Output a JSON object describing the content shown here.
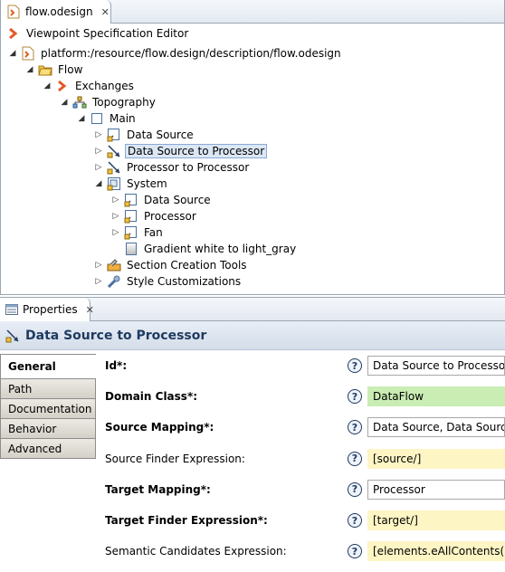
{
  "editor": {
    "tab_label": "flow.odesign",
    "title": "Viewpoint Specification Editor",
    "tree": [
      {
        "label": "platform:/resource/flow.design/description/flow.odesign",
        "icon": "odesign-file-icon",
        "arrow": "expanded",
        "depth": 0,
        "selected": false
      },
      {
        "label": "Flow",
        "icon": "viewpoint-folder-icon",
        "arrow": "expanded",
        "depth": 1,
        "selected": false
      },
      {
        "label": "Exchanges",
        "icon": "representation-icon",
        "arrow": "expanded",
        "depth": 2,
        "selected": false
      },
      {
        "label": "Topography",
        "icon": "diagram-description-icon",
        "arrow": "expanded",
        "depth": 3,
        "selected": false
      },
      {
        "label": "Main",
        "icon": "layer-icon",
        "arrow": "expanded",
        "depth": 4,
        "selected": false
      },
      {
        "label": "Data Source",
        "icon": "node-mapping-icon",
        "arrow": "collapsed",
        "depth": 5,
        "selected": false
      },
      {
        "label": "Data Source to Processor",
        "icon": "edge-mapping-icon",
        "arrow": "collapsed",
        "depth": 5,
        "selected": true
      },
      {
        "label": "Processor  to Processor",
        "icon": "edge-mapping-icon",
        "arrow": "collapsed",
        "depth": 5,
        "selected": false
      },
      {
        "label": "System",
        "icon": "container-mapping-icon",
        "arrow": "expanded",
        "depth": 5,
        "selected": false
      },
      {
        "label": "Data Source",
        "icon": "node-mapping-icon",
        "arrow": "collapsed",
        "depth": 6,
        "selected": false
      },
      {
        "label": "Processor",
        "icon": "node-mapping-icon",
        "arrow": "collapsed",
        "depth": 6,
        "selected": false
      },
      {
        "label": "Fan",
        "icon": "node-mapping-icon",
        "arrow": "collapsed",
        "depth": 6,
        "selected": false
      },
      {
        "label": "Gradient  white to light_gray",
        "icon": "gradient-style-icon",
        "arrow": "none",
        "depth": 6,
        "selected": false
      },
      {
        "label": "Section Creation Tools",
        "icon": "tool-section-icon",
        "arrow": "collapsed",
        "depth": 5,
        "selected": false
      },
      {
        "label": "Style Customizations",
        "icon": "style-customization-icon",
        "arrow": "collapsed",
        "depth": 5,
        "selected": false
      }
    ]
  },
  "properties": {
    "tab_label": "Properties",
    "header_title": "Data Source to Processor",
    "sections": [
      "General",
      "Path",
      "Documentation",
      "Behavior",
      "Advanced"
    ],
    "active_section": "General",
    "fields": [
      {
        "label": "Id*:",
        "bold": true,
        "value": "Data Source to Processor",
        "style": "plain"
      },
      {
        "label": "Domain Class*:",
        "bold": true,
        "value": "DataFlow",
        "style": "green"
      },
      {
        "label": "Source Mapping*:",
        "bold": true,
        "value": "Data Source, Data Source",
        "style": "plain"
      },
      {
        "label": "Source Finder Expression:",
        "bold": false,
        "value": "[source/]",
        "style": "yellow"
      },
      {
        "label": "Target Mapping*:",
        "bold": true,
        "value": "Processor",
        "style": "plain"
      },
      {
        "label": "Target Finder Expression*:",
        "bold": true,
        "value": "[target/]",
        "style": "yellow"
      },
      {
        "label": "Semantic Candidates Expression:",
        "bold": false,
        "value": "[elements.eAllContents()/]",
        "style": "yellow"
      }
    ],
    "help_glyph": "?"
  },
  "colors": {
    "accent": "#1f3a5f",
    "selection": "#dce7f5",
    "required_green": "#c9edb3",
    "expression_yellow": "#fdf5c4"
  }
}
